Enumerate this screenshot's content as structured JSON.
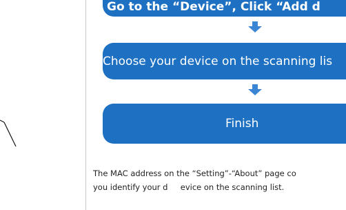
{
  "steps": [
    {
      "label": "Go to the “Device”, Click “Add d"
    },
    {
      "label": "Choose your device on the scanning lis"
    },
    {
      "label": "Finish"
    }
  ],
  "note": {
    "line1": "The MAC address on the “Setting”-“About” page co",
    "line2": "you identify your d     evice on the scanning list."
  },
  "colors": {
    "step_fill": "#1d70c2",
    "arrow_fill": "#3a85d4",
    "divider": "#c8c8c8"
  },
  "icons": [
    "down-arrow-icon",
    "down-arrow-icon"
  ]
}
